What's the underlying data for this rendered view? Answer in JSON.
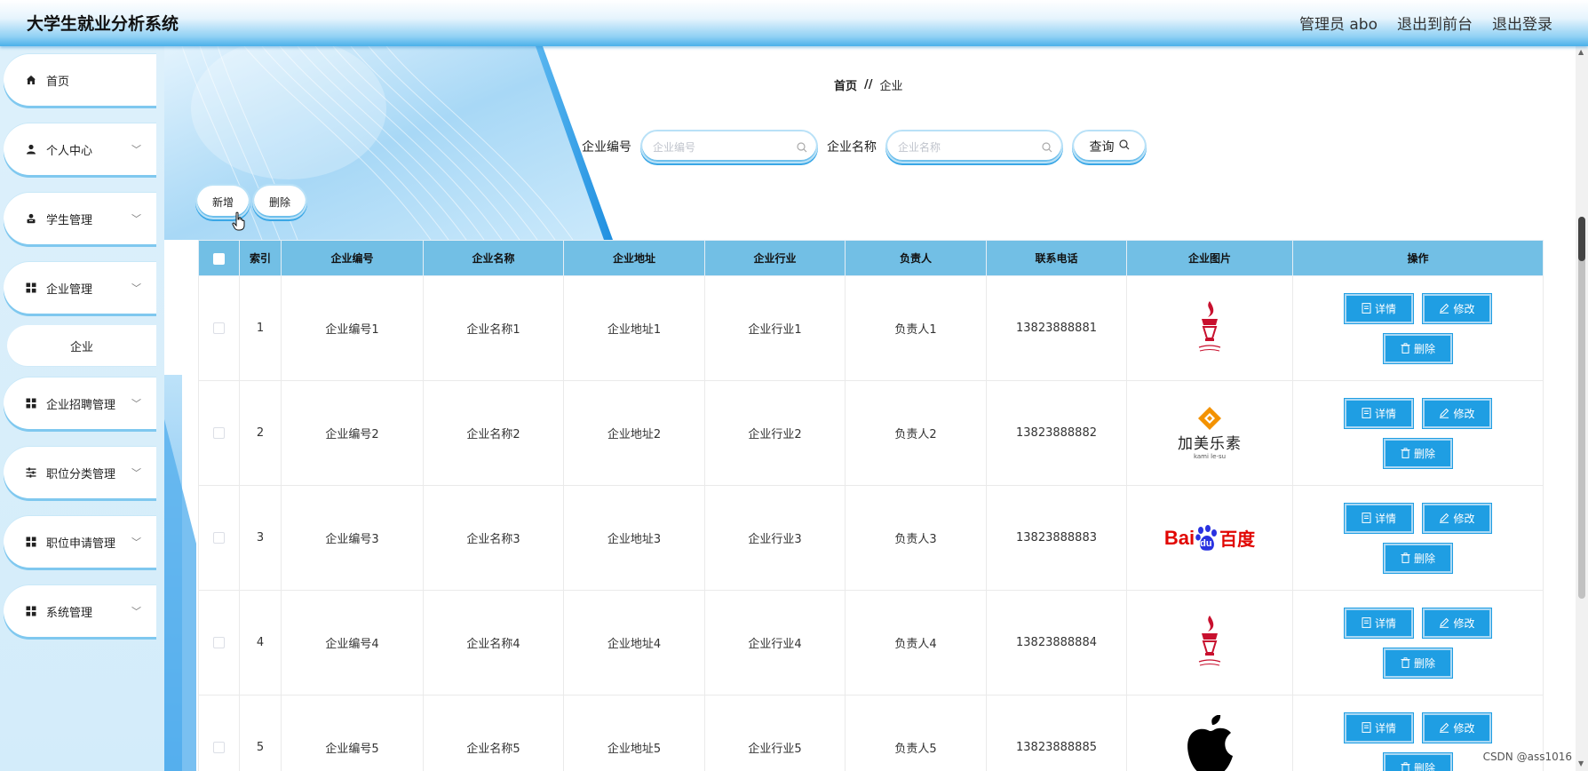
{
  "header": {
    "title": "大学生就业分析系统",
    "links": [
      "管理员 abo",
      "退出到前台",
      "退出登录"
    ]
  },
  "sidebar": {
    "items": [
      {
        "label": "首页",
        "icon": "home-icon"
      },
      {
        "label": "个人中心",
        "icon": "user-icon",
        "expandable": true
      },
      {
        "label": "学生管理",
        "icon": "student-icon",
        "expandable": true
      },
      {
        "label": "企业管理",
        "icon": "grid-icon",
        "expandable": true
      },
      {
        "label": "企业招聘管理",
        "icon": "grid-icon",
        "expandable": true
      },
      {
        "label": "职位分类管理",
        "icon": "sliders-icon",
        "expandable": true
      },
      {
        "label": "职位申请管理",
        "icon": "grid-icon",
        "expandable": true
      },
      {
        "label": "系统管理",
        "icon": "grid-icon",
        "expandable": true
      }
    ],
    "submenu": {
      "label": "企业"
    }
  },
  "breadcrumb": {
    "home": "首页",
    "separator": "//",
    "current": "企业"
  },
  "search": {
    "company_no_label": "企业编号",
    "company_no_placeholder": "企业编号",
    "company_name_label": "企业名称",
    "company_name_placeholder": "企业名称",
    "query_label": "查询"
  },
  "actions": {
    "add_label": "新增",
    "delete_label": "删除"
  },
  "table": {
    "columns": [
      "索引",
      "企业编号",
      "企业名称",
      "企业地址",
      "企业行业",
      "负责人",
      "联系电话",
      "企业图片",
      "操作"
    ],
    "rows": [
      {
        "index": "1",
        "no": "企业编号1",
        "name": "企业名称1",
        "address": "企业地址1",
        "industry": "企业行业1",
        "owner": "负责人1",
        "phone": "13823888881",
        "logo": "torch"
      },
      {
        "index": "2",
        "no": "企业编号2",
        "name": "企业名称2",
        "address": "企业地址2",
        "industry": "企业行业2",
        "owner": "负责人2",
        "phone": "13823888882",
        "logo": "jiamei"
      },
      {
        "index": "3",
        "no": "企业编号3",
        "name": "企业名称3",
        "address": "企业地址3",
        "industry": "企业行业3",
        "owner": "负责人3",
        "phone": "13823888883",
        "logo": "baidu"
      },
      {
        "index": "4",
        "no": "企业编号4",
        "name": "企业名称4",
        "address": "企业地址4",
        "industry": "企业行业4",
        "owner": "负责人4",
        "phone": "13823888884",
        "logo": "torch"
      },
      {
        "index": "5",
        "no": "企业编号5",
        "name": "企业名称5",
        "address": "企业地址5",
        "industry": "企业行业5",
        "owner": "负责人5",
        "phone": "13823888885",
        "logo": "apple"
      }
    ],
    "row_actions": {
      "detail": "详情",
      "edit": "修改",
      "delete": "删除"
    }
  },
  "logo_text": {
    "jiamei_main": "加美乐素",
    "jiamei_sub": "kami le-su",
    "baidu_bai": "Bai",
    "baidu_du": "du",
    "baidu_cn": "百度"
  },
  "watermark": "CSDN @ass1016",
  "colors": {
    "accent": "#1f9ee3",
    "table_header": "#72bfe5",
    "sidebar_bg": "#d8eefa"
  }
}
